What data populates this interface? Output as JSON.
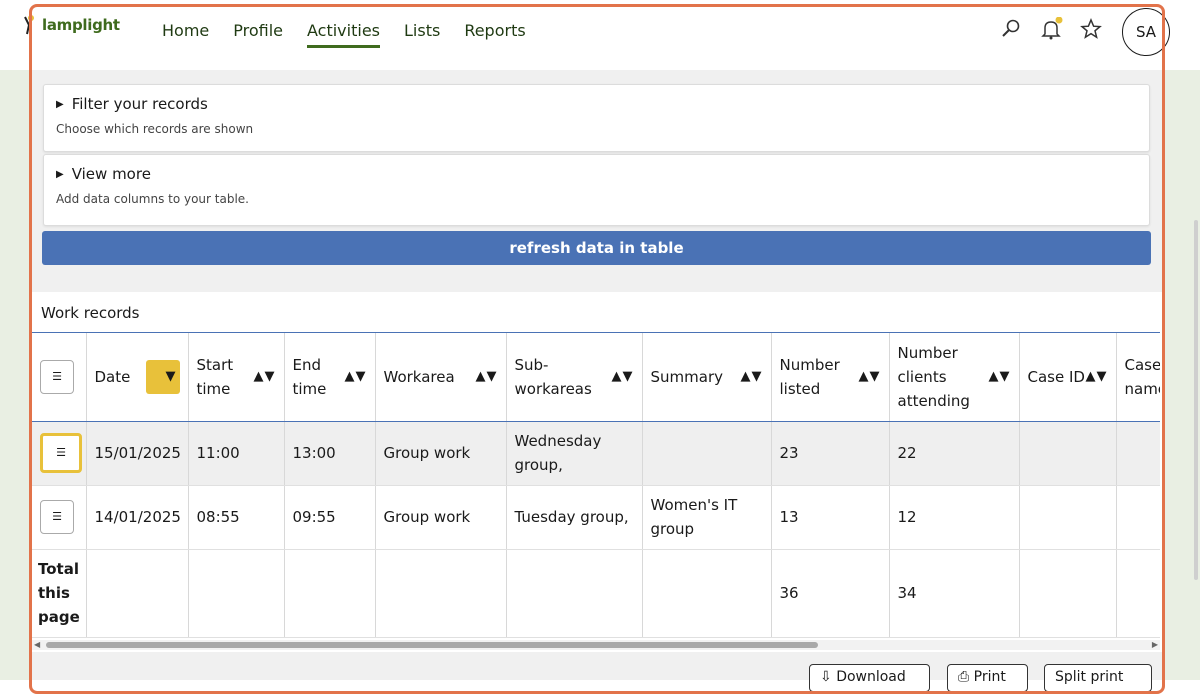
{
  "brand": {
    "name": "lamplight"
  },
  "nav": {
    "links": [
      "Home",
      "Profile",
      "Activities",
      "Lists",
      "Reports"
    ],
    "active": "Activities"
  },
  "user": {
    "initials": "SA"
  },
  "filter_panel": {
    "title": "Filter your records",
    "subtitle": "Choose which records are shown"
  },
  "view_panel": {
    "title": "View more",
    "subtitle": "Add data columns to your table."
  },
  "refresh_button": "refresh data in table",
  "table": {
    "title": "Work records",
    "columns": [
      "Date",
      "Start time",
      "End time",
      "Workarea",
      "Sub-workareas",
      "Summary",
      "Number listed",
      "Number clients attending",
      "Case ID",
      "Case name"
    ],
    "rows": [
      [
        "15/01/2025",
        "11:00",
        "13:00",
        "Group work",
        "Wednesday group,",
        "",
        "23",
        "22",
        "",
        ""
      ],
      [
        "14/01/2025",
        "08:55",
        "09:55",
        "Group work",
        "Tuesday group,",
        "Women's IT group",
        "13",
        "12",
        "",
        ""
      ]
    ],
    "totals_label": "Total this page",
    "totals": [
      "",
      "",
      "",
      "",
      "",
      "",
      "36",
      "34",
      "",
      ""
    ]
  },
  "bottom_buttons": [
    "Download",
    "Print",
    "Split print"
  ],
  "colors": {
    "brand_green": "#3f6b1e",
    "accent_blue": "#4a72b5",
    "highlight_yellow": "#e8c13a",
    "frame_orange": "#e2734a"
  }
}
